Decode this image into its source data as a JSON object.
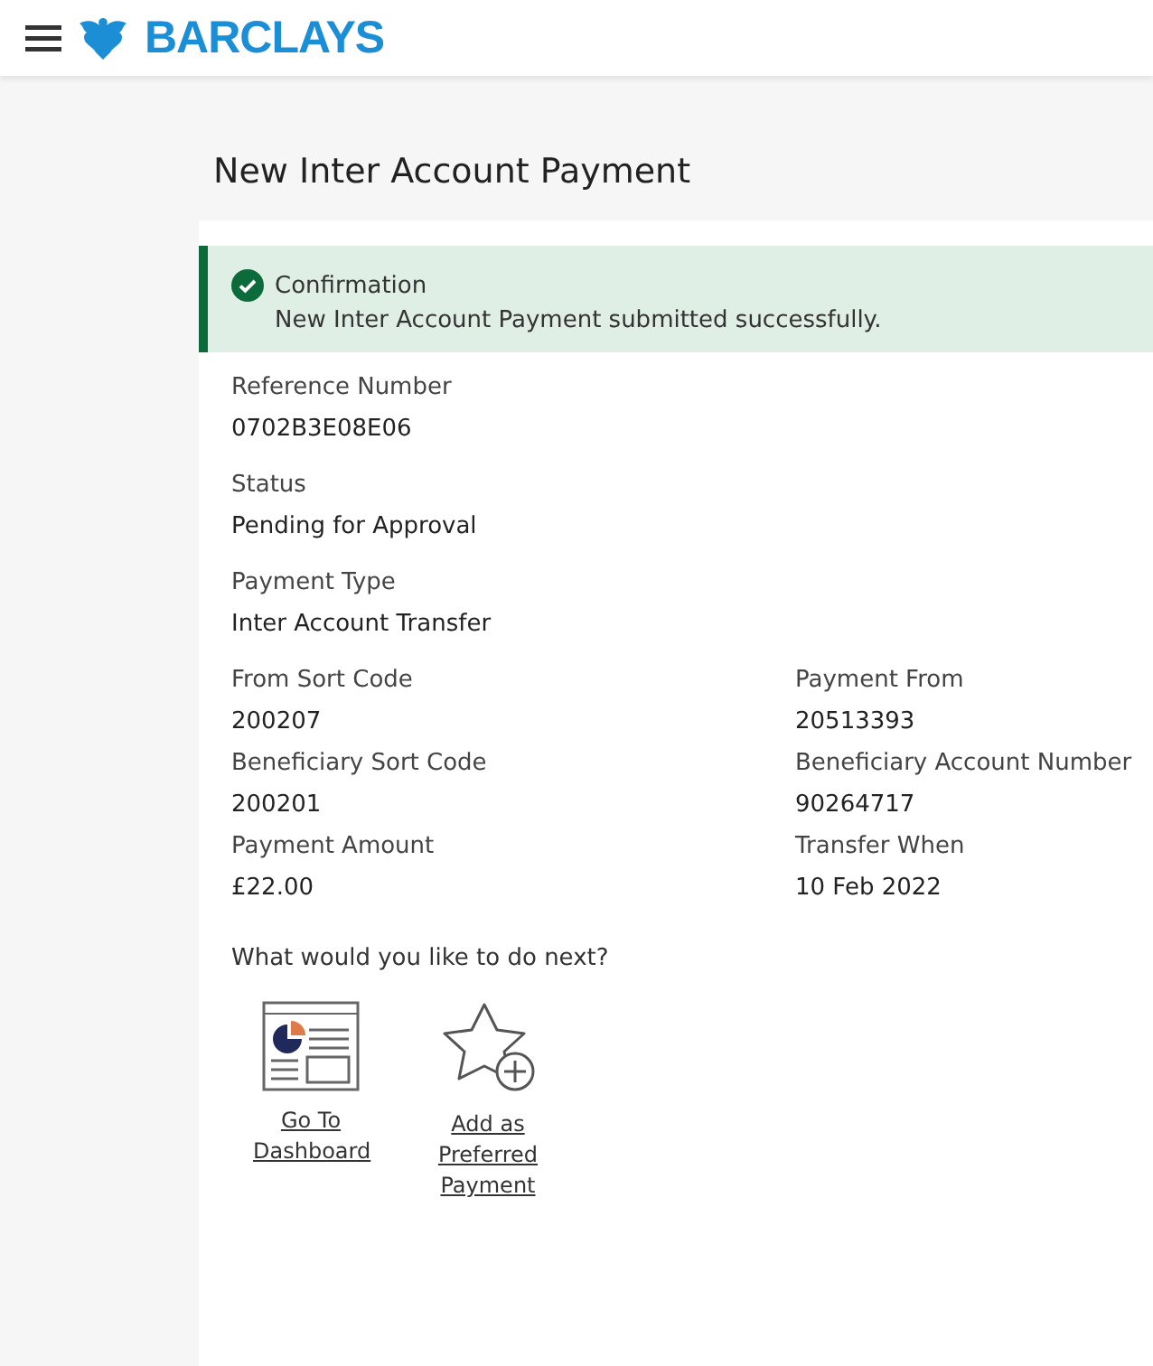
{
  "header": {
    "logo": "BARCLAYS"
  },
  "page_title": "New Inter Account Payment",
  "banner": {
    "title": "Confirmation",
    "message": "New Inter Account Payment submitted successfully."
  },
  "detail_rows": [
    {
      "fields": [
        {
          "label": "Reference Number",
          "value": "0702B3E08E06"
        }
      ]
    },
    {
      "fields": [
        {
          "label": "Status",
          "value": "Pending for Approval"
        }
      ]
    },
    {
      "fields": [
        {
          "label": "Payment Type",
          "value": "Inter Account Transfer"
        }
      ]
    },
    {
      "fields": [
        {
          "label": "From Sort Code",
          "value": "200207"
        },
        {
          "label": "Payment From",
          "value": "20513393"
        }
      ]
    },
    {
      "fields": [
        {
          "label": "Beneficiary Sort Code",
          "value": "200201"
        },
        {
          "label": "Beneficiary Account Number",
          "value": "90264717"
        }
      ]
    },
    {
      "fields": [
        {
          "label": "Payment Amount",
          "value": "£22.00"
        },
        {
          "label": "Transfer When",
          "value": "10 Feb 2022"
        }
      ]
    }
  ],
  "next_prompt": "What would you like to do next?",
  "actions": [
    {
      "kind": "dashboard",
      "label": "Go To Dashboard"
    },
    {
      "kind": "preferred",
      "label": "Add as Preferred Payment"
    }
  ]
}
